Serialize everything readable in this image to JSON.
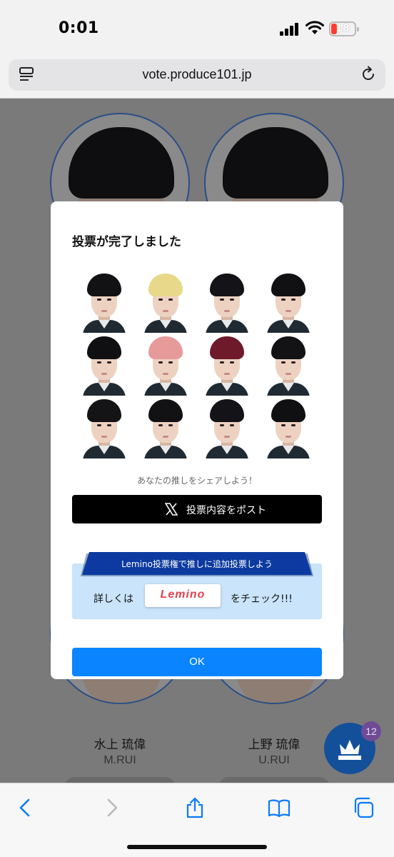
{
  "status_bar": {
    "time": "0:01",
    "battery_level": "18",
    "battery_color": "#ff3b30"
  },
  "browser": {
    "url": "vote.produce101.jp",
    "icons": [
      "reader-icon",
      "reload-icon",
      "back-icon",
      "forward-icon",
      "share-icon",
      "bookmarks-icon",
      "tabs-icon"
    ]
  },
  "background_page": {
    "candidates": [
      {
        "name": "水上 琉偉",
        "roman": "M.RUI"
      },
      {
        "name": "上野 琉偉",
        "roman": "U.RUI"
      }
    ],
    "vote_badge_count": "12",
    "accent_color": "#14509a"
  },
  "modal": {
    "title": "投票が完了しました",
    "voted_thumbnails": [
      {
        "hair": "#121214"
      },
      {
        "hair": "#e8d98a"
      },
      {
        "hair": "#141418"
      },
      {
        "hair": "#111114"
      },
      {
        "hair": "#101012"
      },
      {
        "hair": "#e79a9a"
      },
      {
        "hair": "#6e1a2a"
      },
      {
        "hair": "#131315"
      },
      {
        "hair": "#141416"
      },
      {
        "hair": "#121214"
      },
      {
        "hair": "#141418"
      },
      {
        "hair": "#101012"
      }
    ],
    "share_prompt": "あなたの推しをシェアしよう！",
    "post_button": "投票内容をポスト",
    "lemino_banner": "Lemino投票権で推しに追加投票しよう",
    "lemino_detail_before": "詳しくは",
    "lemino_logo": "Lemino",
    "lemino_detail_after": "をチェック!!!",
    "ok_button": "OK",
    "ok_color": "#0a84ff"
  }
}
